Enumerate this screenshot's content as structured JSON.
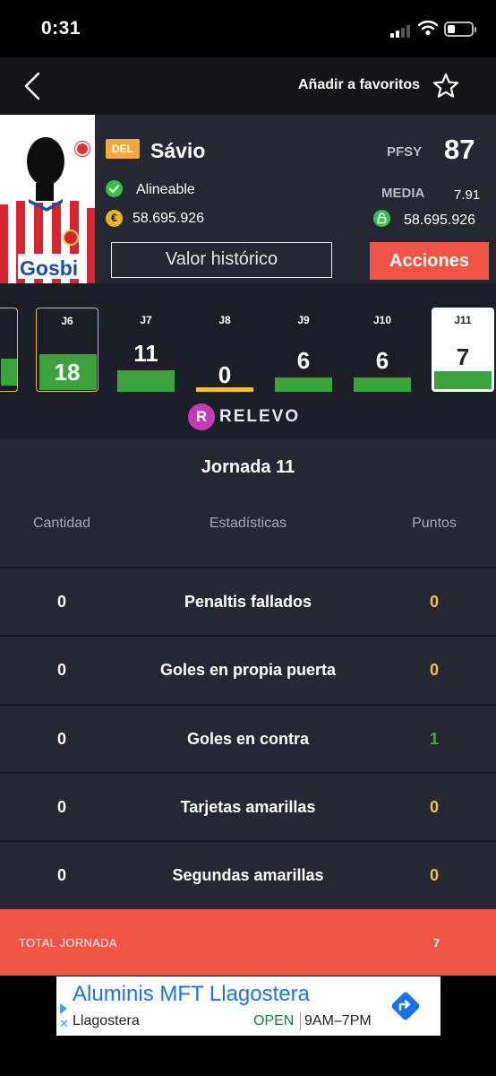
{
  "status_bar": {
    "time": "0:31"
  },
  "nav": {
    "favorite_label": "Añadir a favoritos"
  },
  "player": {
    "position": "DEL",
    "name": "Sávio",
    "status": "Alineable",
    "value": "58.695.926",
    "pfsy_label": "PFSY",
    "pfsy": "87",
    "media_label": "MEDIA",
    "media": "7.91",
    "market_value": "58.695.926",
    "coin_symbol": "€"
  },
  "buttons": {
    "history": "Valor histórico",
    "actions": "Acciones"
  },
  "rounds": [
    {
      "label": "J6",
      "points": "18",
      "bar_color": "#3ca33c",
      "style": "gold"
    },
    {
      "label": "J7",
      "points": "11",
      "bar_color": "#3ca33c",
      "style": "normal"
    },
    {
      "label": "J8",
      "points": "0",
      "bar_color": "#f3c12f",
      "style": "normal"
    },
    {
      "label": "J9",
      "points": "6",
      "bar_color": "#3ca33c",
      "style": "normal"
    },
    {
      "label": "J10",
      "points": "6",
      "bar_color": "#3ca33c",
      "style": "normal"
    },
    {
      "label": "J11",
      "points": "7",
      "bar_color": "#3ca33c",
      "style": "active"
    }
  ],
  "brand": {
    "name": "RELEVO",
    "logo_letter": "R"
  },
  "stats": {
    "title": "Jornada 11",
    "headers": {
      "qty": "Cantidad",
      "stat": "Estadísticas",
      "points": "Puntos"
    },
    "rows": [
      {
        "qty": "0",
        "name": "Penaltis fallados",
        "points": "0",
        "color": "#f2c33c"
      },
      {
        "qty": "0",
        "name": "Goles en propia puerta",
        "points": "0",
        "color": "#f2c33c"
      },
      {
        "qty": "0",
        "name": "Goles en contra",
        "points": "1",
        "color": "#3fae3f"
      },
      {
        "qty": "0",
        "name": "Tarjetas amarillas",
        "points": "0",
        "color": "#f2c33c"
      },
      {
        "qty": "0",
        "name": "Segundas amarillas",
        "points": "0",
        "color": "#f2c33c"
      }
    ],
    "total_label": "TOTAL JORNADA",
    "total_value": "7"
  },
  "ad": {
    "title": "Aluminis MFT Llagostera",
    "subtitle": "Llagostera",
    "open": "OPEN",
    "hours": "9AM–7PM"
  },
  "colors": {
    "accent": "#ee5544",
    "card_bg": "#252833",
    "strip_bg": "#1c1e27",
    "gold": "#e8b93a",
    "green": "#3ca33c"
  }
}
